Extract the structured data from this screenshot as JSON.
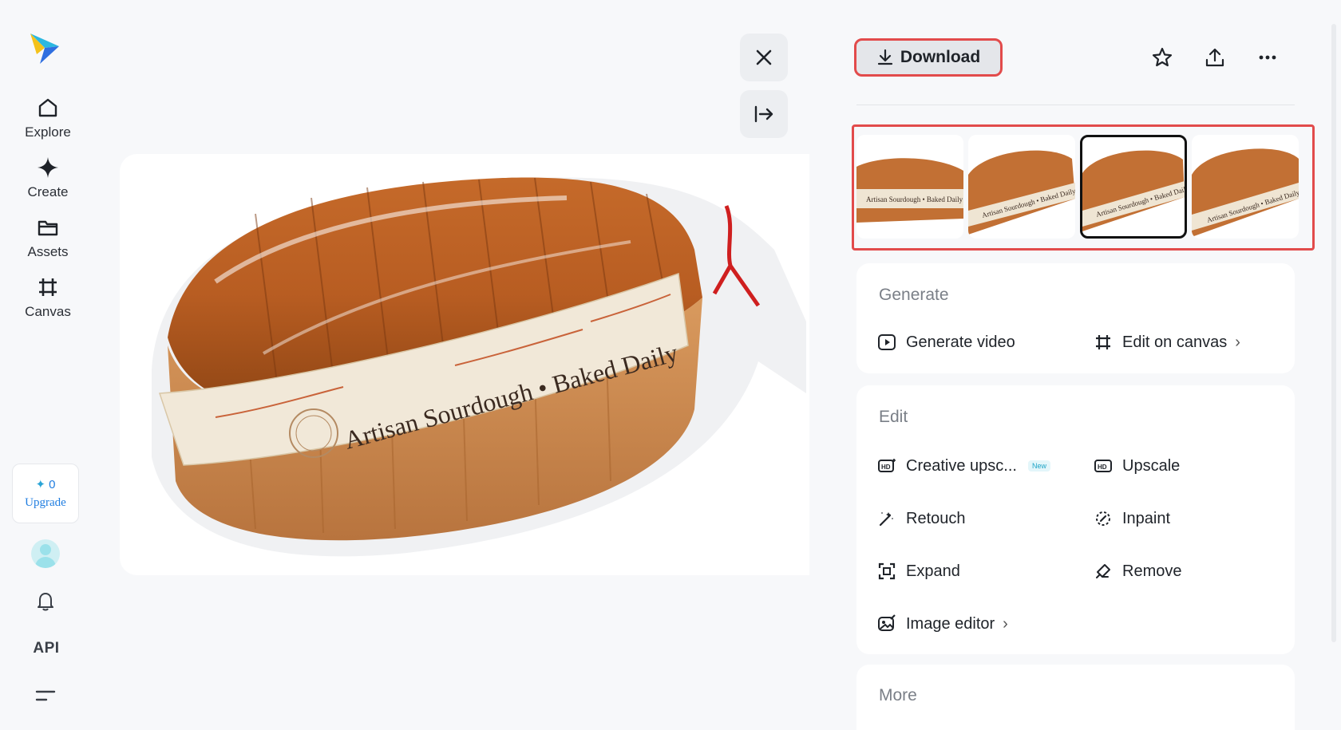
{
  "sidebar": {
    "items": [
      {
        "label": "Explore",
        "icon": "home-icon"
      },
      {
        "label": "Create",
        "icon": "sparkle-icon"
      },
      {
        "label": "Assets",
        "icon": "folder-icon"
      },
      {
        "label": "Canvas",
        "icon": "crop-icon"
      }
    ],
    "credits": "0",
    "upgrade_label": "Upgrade",
    "api_label": "API"
  },
  "image": {
    "label_text": "Artisan Sourdough • Baked Daily"
  },
  "toolbar": {
    "download_label": "Download"
  },
  "thumbnails": {
    "selected_index": 2,
    "items": [
      {
        "label": "Artisan Sourdough • Baked Daily"
      },
      {
        "label": "Artisan Sourdough • Baked Daily"
      },
      {
        "label": "Artisan Sourdough • Baked Daily"
      },
      {
        "label": "Artisan Sourdough • Baked Daily"
      }
    ]
  },
  "generate": {
    "title": "Generate",
    "actions": [
      {
        "label": "Generate video"
      },
      {
        "label": "Edit on canvas"
      }
    ]
  },
  "edit": {
    "title": "Edit",
    "new_badge": "New",
    "actions": [
      {
        "label": "Creative upsc..."
      },
      {
        "label": "Upscale"
      },
      {
        "label": "Retouch"
      },
      {
        "label": "Inpaint"
      },
      {
        "label": "Expand"
      },
      {
        "label": "Remove"
      },
      {
        "label": "Image editor"
      }
    ]
  },
  "more": {
    "title": "More"
  },
  "colors": {
    "accent_red": "#e24b4b",
    "brand_blue": "#1f7de0"
  }
}
